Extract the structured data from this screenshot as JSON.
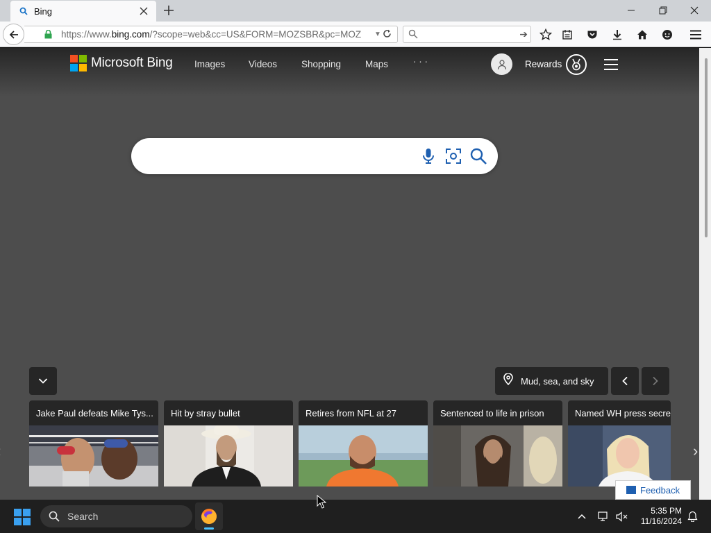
{
  "browser": {
    "tab_title": "Bing",
    "url_prefix": "https://www.",
    "url_host": "bing.com",
    "url_rest": "/?scope=web&cc=US&FORM=MOZSBR&pc=MOZ",
    "search_placeholder": ""
  },
  "bing": {
    "logo_text": "Microsoft Bing",
    "nav": {
      "images": "Images",
      "videos": "Videos",
      "shopping": "Shopping",
      "maps": "Maps",
      "more": "· · ·"
    },
    "rewards_label": "Rewards",
    "search_value": "",
    "location_label": "Mud, sea, and sky",
    "feedback_label": "Feedback",
    "cards": [
      {
        "title": "Jake Paul defeats Mike Tys..."
      },
      {
        "title": "Hit by stray bullet"
      },
      {
        "title": "Retires from NFL at 27"
      },
      {
        "title": "Sentenced to life in prison"
      },
      {
        "title": "Named WH press secre"
      }
    ]
  },
  "taskbar": {
    "search_label": "Search",
    "time": "5:35 PM",
    "date": "11/16/2024"
  },
  "colors": {
    "ms_red": "#f25022",
    "ms_green": "#7fba00",
    "ms_blue": "#00a4ef",
    "ms_yellow": "#ffb900",
    "bing_icon_blue": "#1e5fb0"
  }
}
